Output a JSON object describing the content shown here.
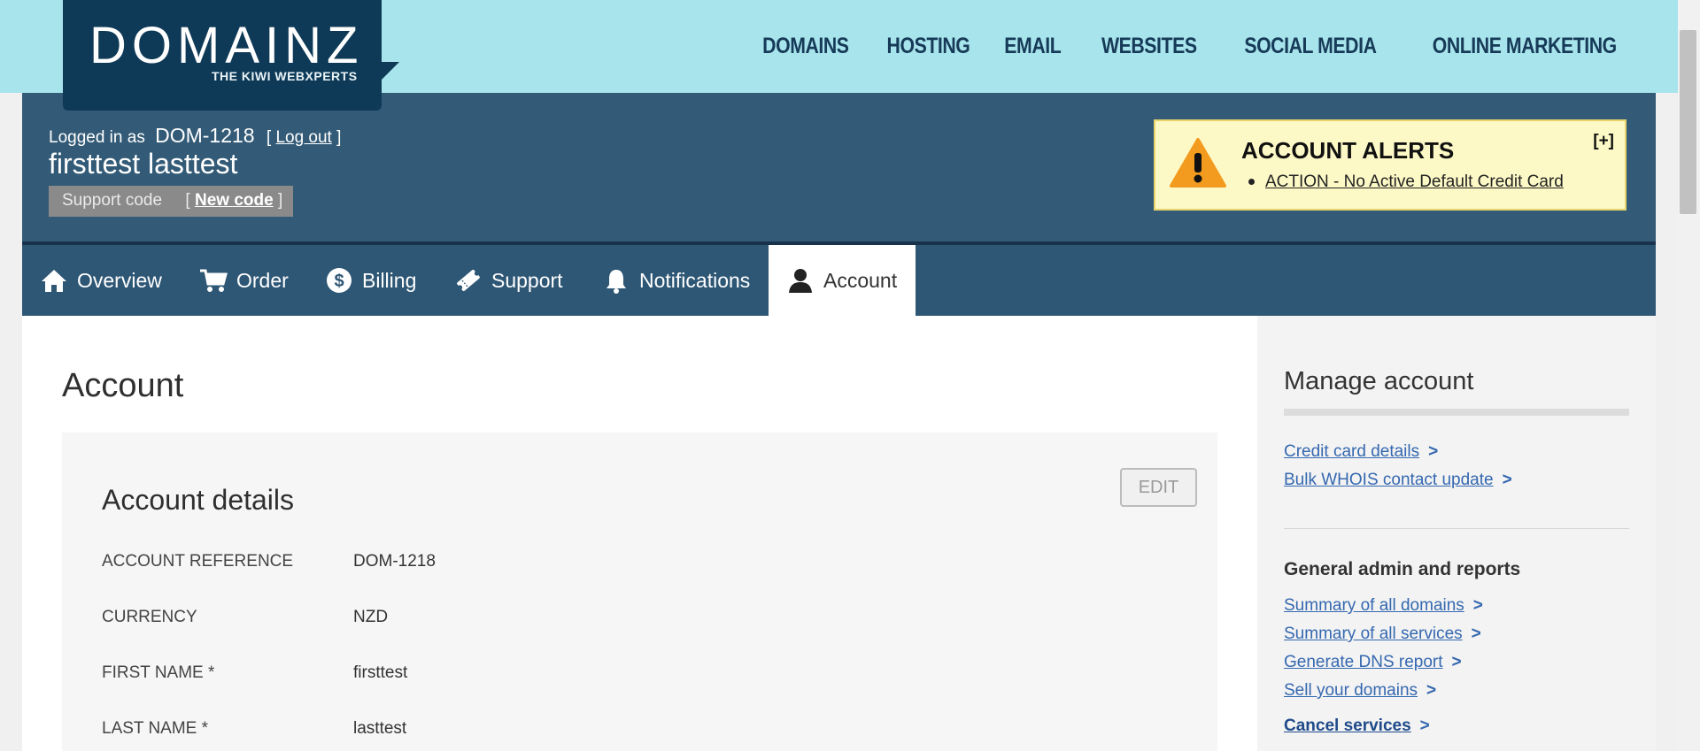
{
  "brand": {
    "name": "DOMAINZ",
    "tagline": "THE KIWI WEBXPERTS"
  },
  "topnav": [
    "DOMAINS",
    "HOSTING",
    "EMAIL",
    "WEBSITES",
    "SOCIAL MEDIA",
    "ONLINE MARKETING"
  ],
  "user": {
    "logged_in_label": "Logged in as",
    "account_id": "DOM-1218",
    "logout_label": "Log out",
    "full_name": "firsttest lasttest",
    "support_code_label": "Support code",
    "new_code_label": "New code"
  },
  "alerts": {
    "title": "ACCOUNT ALERTS",
    "toggle": "[+]",
    "items": [
      "ACTION - No Active Default Credit Card"
    ]
  },
  "tabs": [
    {
      "label": "Overview",
      "icon": "home-icon"
    },
    {
      "label": "Order",
      "icon": "cart-icon"
    },
    {
      "label": "Billing",
      "icon": "dollar-icon"
    },
    {
      "label": "Support",
      "icon": "ticket-icon"
    },
    {
      "label": "Notifications",
      "icon": "bell-icon"
    },
    {
      "label": "Account",
      "icon": "user-icon",
      "active": true
    }
  ],
  "main": {
    "title": "Account",
    "card_title": "Account details",
    "edit_label": "EDIT",
    "details": [
      {
        "label": "ACCOUNT REFERENCE",
        "value": "DOM-1218"
      },
      {
        "label": "CURRENCY",
        "value": "NZD"
      },
      {
        "label": "FIRST NAME *",
        "value": "firsttest"
      },
      {
        "label": "LAST NAME *",
        "value": "lasttest"
      }
    ]
  },
  "sidebar": {
    "title": "Manage account",
    "links": [
      "Credit card details",
      "Bulk WHOIS contact update"
    ],
    "section_title": "General admin and reports",
    "admin_links": [
      "Summary of all domains",
      "Summary of all services",
      "Generate DNS report",
      "Sell your domains"
    ],
    "cancel_link": "Cancel services"
  },
  "colors": {
    "topbar": "#a8e4ec",
    "header": "#335b77",
    "tabbar": "#2e5775",
    "alert_bg": "#fdf9c6",
    "link": "#3568b0"
  }
}
